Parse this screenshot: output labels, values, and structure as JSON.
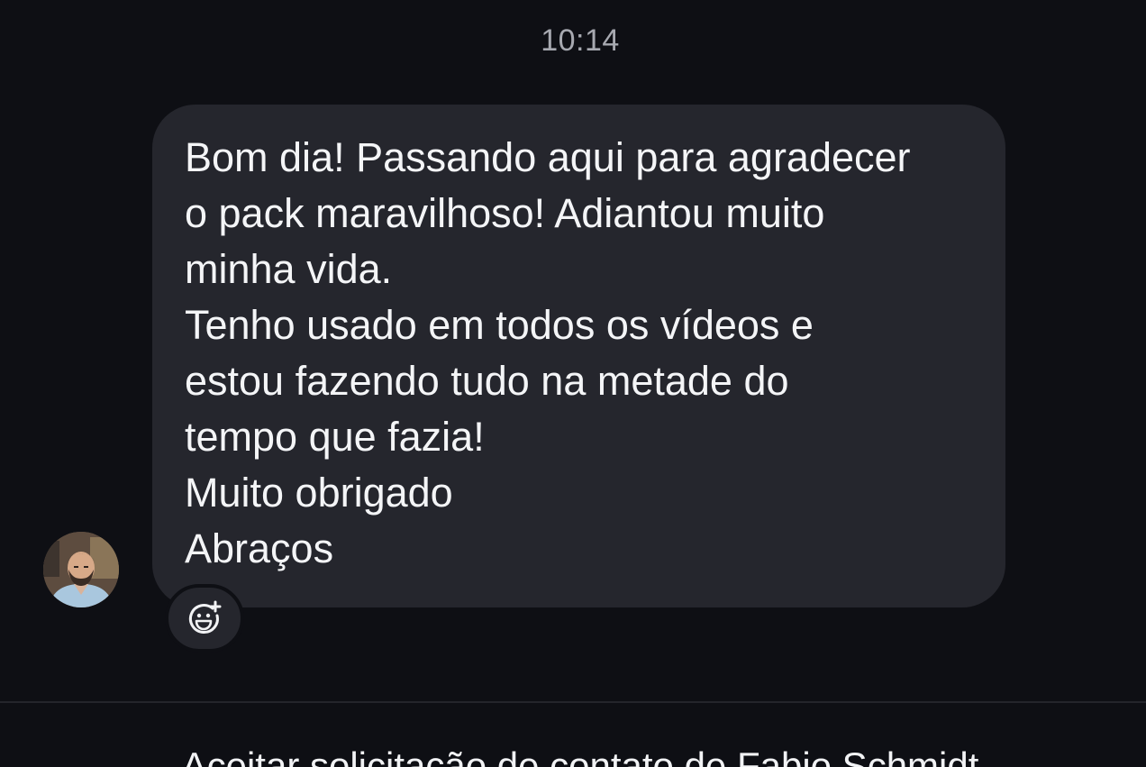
{
  "conversation": {
    "timestamp": "10:14",
    "message": {
      "lines": [
        "Bom dia! Passando aqui para agradecer",
        "o pack maravilhoso! Adiantou muito",
        "minha vida.",
        "Tenho usado em todos os vídeos e",
        "estou fazendo tudo na metade do",
        "tempo que fazia!",
        "Muito obrigado",
        "Abraços"
      ]
    },
    "reaction_icon": "add-reaction-icon"
  },
  "footer": {
    "accept_request_label": "Aceitar solicitação de contato de Fabio Schmidt"
  },
  "colors": {
    "background": "#0e0f14",
    "bubble": "#25262d",
    "timestamp": "#a7a9b0",
    "text": "#f4f5f7"
  }
}
